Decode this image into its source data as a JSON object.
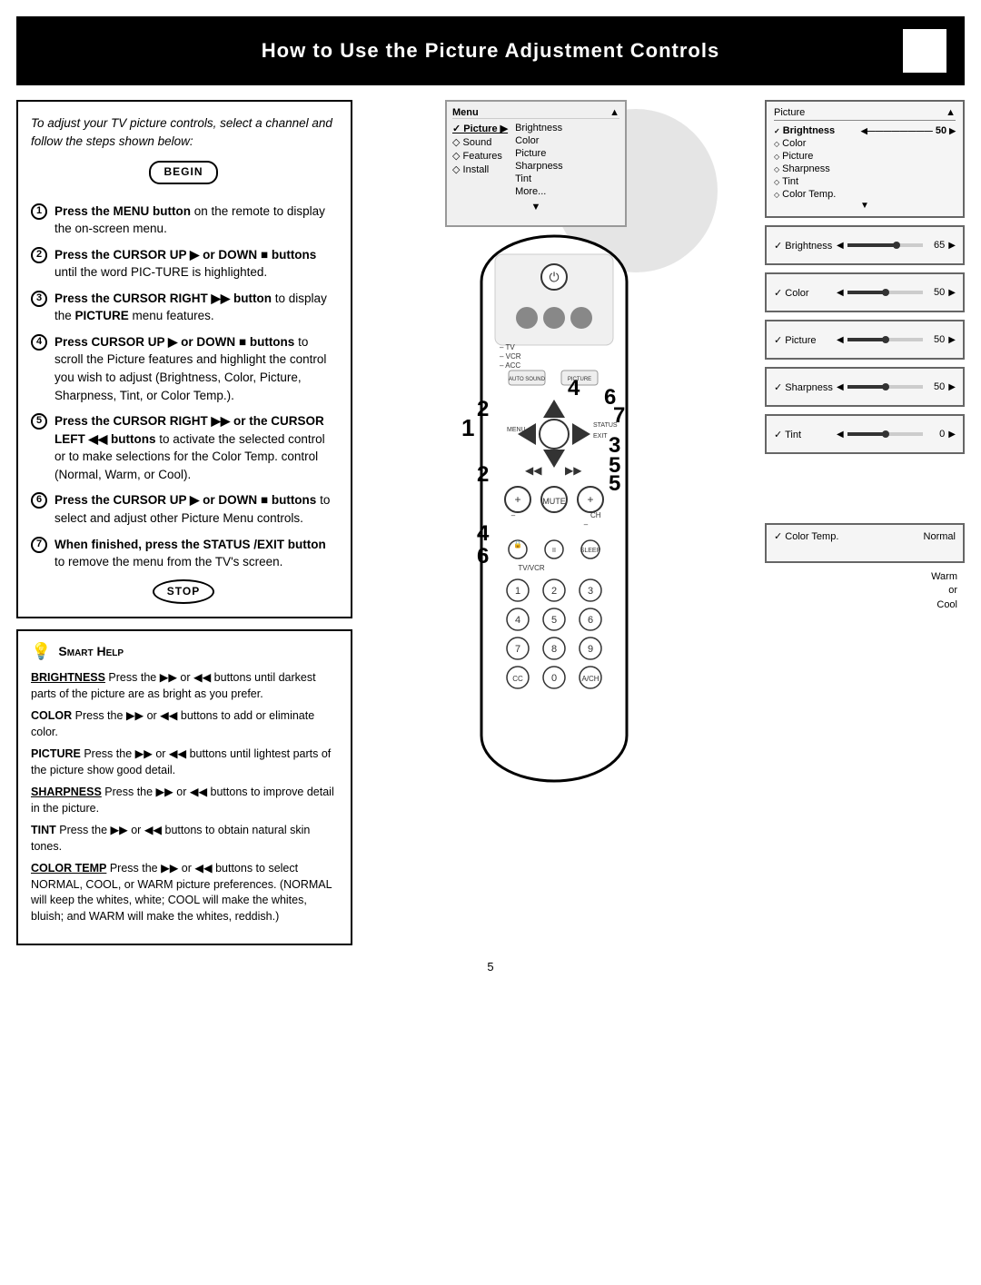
{
  "header": {
    "title": "How to Use the Picture Adjustment Controls"
  },
  "intro": {
    "text": "To adjust your TV picture controls, select a channel and follow the steps shown below:"
  },
  "begin_label": "BEGIN",
  "stop_label": "STOP",
  "steps": [
    {
      "num": "1",
      "text_parts": [
        {
          "bold": true,
          "text": "Press the MENU button"
        },
        {
          "bold": false,
          "text": " on the remote to display the on-screen menu."
        }
      ]
    },
    {
      "num": "2",
      "text_parts": [
        {
          "bold": true,
          "text": "Press the CURSOR UP ▶ or DOWN ■ buttons"
        },
        {
          "bold": false,
          "text": " until the word PIC-TURE is highlighted."
        }
      ]
    },
    {
      "num": "3",
      "text_parts": [
        {
          "bold": true,
          "text": "Press the CURSOR RIGHT ▶▶ button"
        },
        {
          "bold": false,
          "text": " to display the "
        },
        {
          "bold": true,
          "text": "PICTURE"
        },
        {
          "bold": false,
          "text": " menu features."
        }
      ]
    },
    {
      "num": "4",
      "text_parts": [
        {
          "bold": true,
          "text": "Press CURSOR UP ▶ or DOWN ■ buttons"
        },
        {
          "bold": false,
          "text": " to scroll the Picture features and highlight the control you wish to adjust (Brightness, Color, Picture, Sharpness, Tint, or Color Temp.)."
        }
      ]
    },
    {
      "num": "5",
      "text_parts": [
        {
          "bold": true,
          "text": "Press the CURSOR RIGHT ▶▶ or the CURSOR LEFT ◀◀ buttons"
        },
        {
          "bold": false,
          "text": " to activate the selected control or to make selections for the Color Temp. control (Normal, Warm, or Cool)."
        }
      ]
    },
    {
      "num": "6",
      "text_parts": [
        {
          "bold": true,
          "text": "Press the CURSOR UP ▶ or DOWN ■ buttons"
        },
        {
          "bold": false,
          "text": " to select and adjust other Picture Menu controls."
        }
      ]
    },
    {
      "num": "7",
      "text_parts": [
        {
          "bold": true,
          "text": "When finished, press the STATUS /EXIT button"
        },
        {
          "bold": false,
          "text": " to remove the menu from the TV's screen."
        }
      ]
    }
  ],
  "smart_help": {
    "title": "Smart Help",
    "items": [
      {
        "label": "BRIGHTNESS",
        "text": " Press the ▶▶ or ◀◀ buttons until darkest parts of the picture are as bright as you prefer."
      },
      {
        "label": "COLOR",
        "text": " Press the ▶▶ or ◀◀ buttons to add or eliminate color."
      },
      {
        "label": "PICTURE",
        "text": " Press the ▶▶ or ◀◀ buttons until lightest parts of the picture show good detail."
      },
      {
        "label": "SHARPNESS",
        "text": " Press the ▶▶ or ◀◀ buttons to improve detail in the picture."
      },
      {
        "label": "TINT",
        "text": " Press the ▶▶ or ◀◀ buttons to obtain natural skin tones."
      },
      {
        "label": "COLOR TEMP",
        "text": " Press the ▶▶ or ◀◀ buttons to select NORMAL, COOL, or WARM picture preferences. (NORMAL will keep the whites, white; COOL will make the whites, bluish; and WARM will make the whites, reddish.)"
      }
    ]
  },
  "menu_screen": {
    "header_left": "Menu",
    "header_right": "▲",
    "left_items": [
      "✓ Picture",
      "◇ Sound",
      "◇ Features",
      "◇ Install"
    ],
    "right_items": [
      "Brightness",
      "Color",
      "Picture",
      "Sharpness",
      "Tint",
      "More..."
    ],
    "arrow_down": "▼"
  },
  "picture_menu_screen": {
    "header_left": "Picture",
    "header_right": "▲",
    "items": [
      {
        "check": true,
        "label": "Brightness",
        "value": "50",
        "has_bar": true
      },
      {
        "check": false,
        "label": "Color",
        "value": ""
      },
      {
        "check": false,
        "label": "Picture",
        "value": ""
      },
      {
        "check": false,
        "label": "Sharpness",
        "value": ""
      },
      {
        "check": false,
        "label": "Tint",
        "value": ""
      },
      {
        "check": false,
        "label": "Color Temp.",
        "value": ""
      }
    ]
  },
  "slider_screens": [
    {
      "label": "Brightness",
      "value": 65,
      "display": "65"
    },
    {
      "label": "Color",
      "value": 50,
      "display": "50"
    },
    {
      "label": "Picture",
      "value": 50,
      "display": "50"
    },
    {
      "label": "Sharpness",
      "value": 50,
      "display": "50"
    },
    {
      "label": "Tint",
      "value": 0,
      "display": "0"
    }
  ],
  "color_temp_screen": {
    "label": "Color Temp.",
    "value": "Normal",
    "note": "Warm\nor\nCool"
  },
  "page_number": "5",
  "annotations": [
    "1",
    "2",
    "3",
    "4",
    "5",
    "6",
    "7"
  ],
  "remote_buttons": {
    "power": "⏻",
    "menu": "MENU",
    "exit": "EXIT",
    "status": "STATUS",
    "auto_sound": "AUTO SOUND",
    "picture": "PICTURE",
    "mute": "MUTE",
    "ch": "CH",
    "cursor_up": "▲",
    "cursor_down": "▼",
    "cursor_left": "◀",
    "cursor_right": "▶",
    "ok": "●"
  }
}
